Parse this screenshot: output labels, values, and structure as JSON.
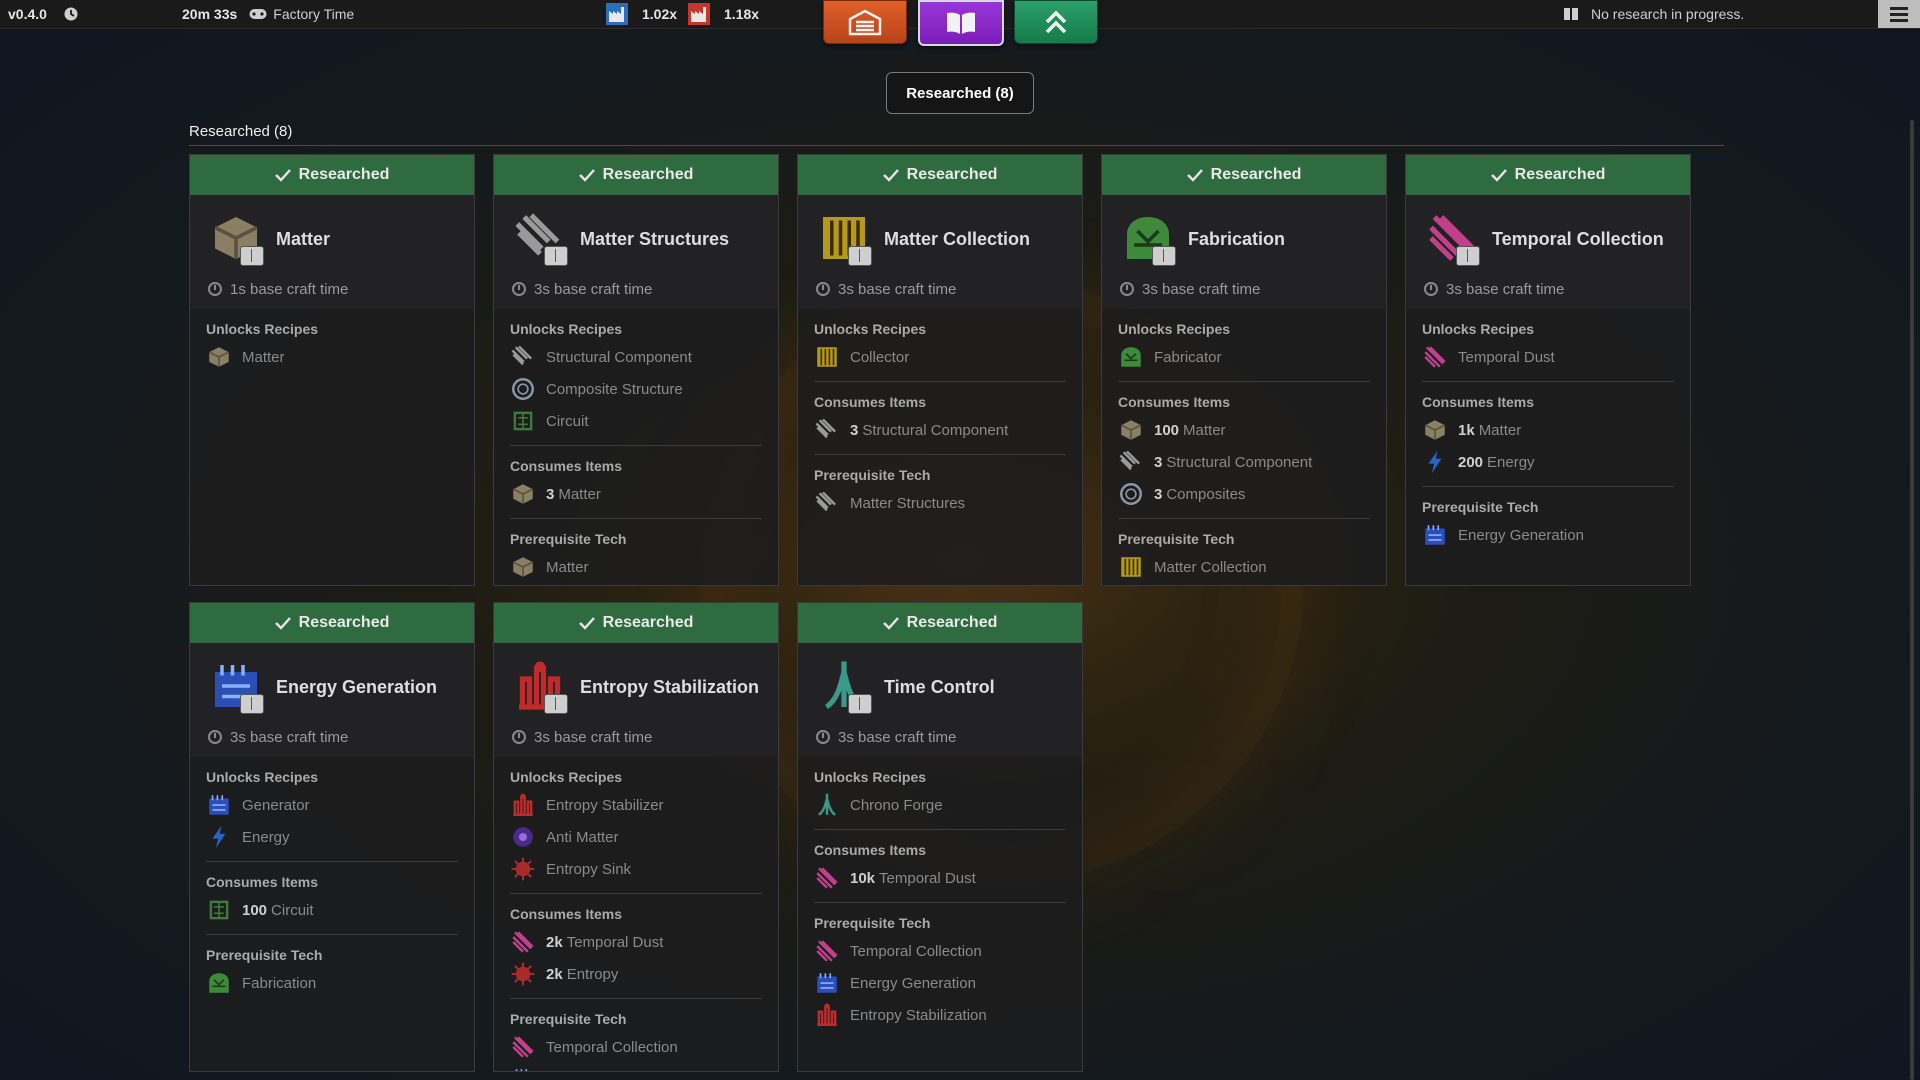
{
  "topbar": {
    "version": "v0.4.0",
    "elapsed": "20m 33s",
    "factory_time_label": "Factory Time",
    "speed_1": "1.02x",
    "speed_2": "1.18x",
    "research_status": "No research in progress."
  },
  "nav": {
    "factory_icon": "factory-icon",
    "research_icon": "book-icon",
    "upgrades_icon": "double-chevron-up-icon"
  },
  "filter": {
    "label": "Researched (8)"
  },
  "section": {
    "title": "Researched (8)"
  },
  "labels": {
    "status": "Researched",
    "unlocks": "Unlocks Recipes",
    "consumes": "Consumes Items",
    "prereq": "Prerequisite Tech"
  },
  "cards": [
    {
      "title": "Matter",
      "icon": "matter",
      "time": "1s base craft time",
      "unlocks": [
        {
          "icon": "matter",
          "name": "Matter"
        }
      ],
      "consumes": [],
      "prereq": []
    },
    {
      "title": "Matter Structures",
      "icon": "structural",
      "time": "3s base craft time",
      "unlocks": [
        {
          "icon": "structural",
          "name": "Structural Component"
        },
        {
          "icon": "composite",
          "name": "Composite Structure"
        },
        {
          "icon": "circuit",
          "name": "Circuit"
        }
      ],
      "consumes": [
        {
          "icon": "matter",
          "qty": "3",
          "name": "Matter"
        }
      ],
      "prereq": [
        {
          "icon": "matter",
          "name": "Matter"
        }
      ]
    },
    {
      "title": "Matter Collection",
      "icon": "collector",
      "time": "3s base craft time",
      "unlocks": [
        {
          "icon": "collector",
          "name": "Collector"
        }
      ],
      "consumes": [
        {
          "icon": "structural",
          "qty": "3",
          "name": "Structural Component"
        }
      ],
      "prereq": [
        {
          "icon": "structural",
          "name": "Matter Structures"
        }
      ]
    },
    {
      "title": "Fabrication",
      "icon": "fabricator",
      "time": "3s base craft time",
      "unlocks": [
        {
          "icon": "fabricator",
          "name": "Fabricator"
        }
      ],
      "consumes": [
        {
          "icon": "matter",
          "qty": "100",
          "name": "Matter"
        },
        {
          "icon": "structural",
          "qty": "3",
          "name": "Structural Component"
        },
        {
          "icon": "composite",
          "qty": "3",
          "name": "Composites"
        }
      ],
      "prereq": [
        {
          "icon": "collector",
          "name": "Matter Collection"
        }
      ]
    },
    {
      "title": "Temporal Collection",
      "icon": "temporal",
      "time": "3s base craft time",
      "unlocks": [
        {
          "icon": "temporal",
          "name": "Temporal Dust"
        }
      ],
      "consumes": [
        {
          "icon": "matter",
          "qty": "1k",
          "name": "Matter"
        },
        {
          "icon": "energy",
          "qty": "200",
          "name": "Energy"
        }
      ],
      "prereq": [
        {
          "icon": "generator",
          "name": "Energy Generation"
        }
      ]
    },
    {
      "title": "Energy Generation",
      "icon": "generator",
      "time": "3s base craft time",
      "unlocks": [
        {
          "icon": "generator",
          "name": "Generator"
        },
        {
          "icon": "energy",
          "name": "Energy"
        }
      ],
      "consumes": [
        {
          "icon": "circuit",
          "qty": "100",
          "name": "Circuit"
        }
      ],
      "prereq": [
        {
          "icon": "fabricator",
          "name": "Fabrication"
        }
      ]
    },
    {
      "title": "Entropy Stabilization",
      "icon": "stabilizer",
      "time": "3s base craft time",
      "unlocks": [
        {
          "icon": "stabilizer",
          "name": "Entropy Stabilizer"
        },
        {
          "icon": "antimatter",
          "name": "Anti Matter"
        },
        {
          "icon": "entropy",
          "name": "Entropy Sink"
        }
      ],
      "consumes": [
        {
          "icon": "temporal",
          "qty": "2k",
          "name": "Temporal Dust"
        },
        {
          "icon": "entropy",
          "qty": "2k",
          "name": "Entropy"
        }
      ],
      "prereq": [
        {
          "icon": "temporal",
          "name": "Temporal Collection"
        },
        {
          "icon": "generator",
          "name": "Energy Generation"
        }
      ]
    },
    {
      "title": "Time Control",
      "icon": "chrono",
      "time": "3s base craft time",
      "unlocks": [
        {
          "icon": "chrono",
          "name": "Chrono Forge"
        }
      ],
      "consumes": [
        {
          "icon": "temporal",
          "qty": "10k",
          "name": "Temporal Dust"
        }
      ],
      "prereq": [
        {
          "icon": "temporal",
          "name": "Temporal Collection"
        },
        {
          "icon": "generator",
          "name": "Energy Generation"
        },
        {
          "icon": "stabilizer",
          "name": "Entropy Stabilization"
        }
      ]
    }
  ]
}
